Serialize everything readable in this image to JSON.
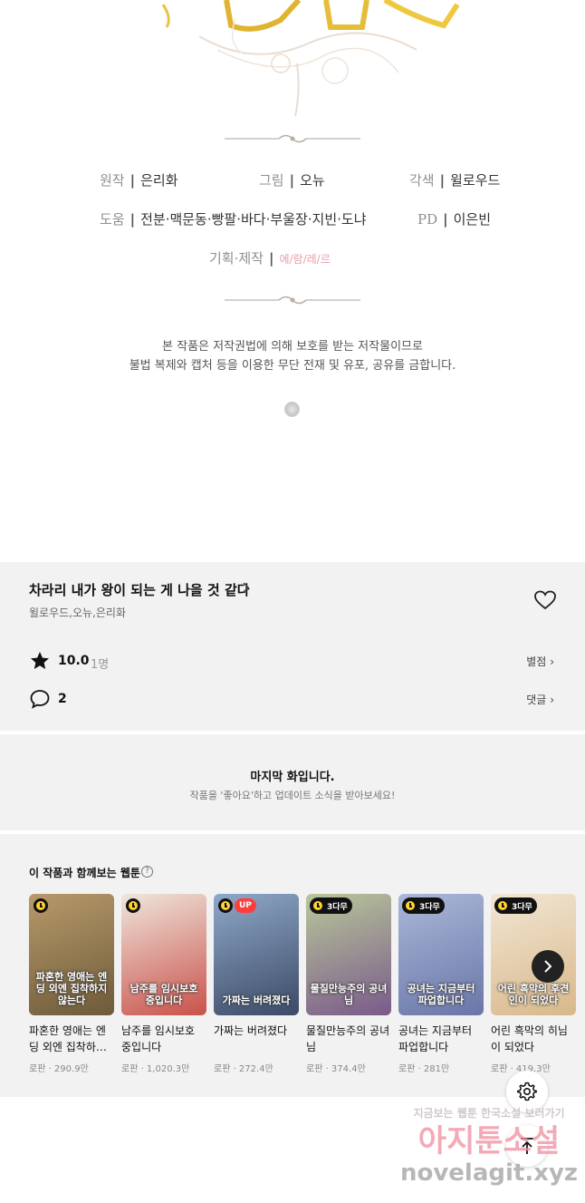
{
  "credits": {
    "rows": [
      [
        {
          "label": "원작",
          "value": "은리화"
        },
        {
          "label": "그림",
          "value": "오뉴"
        },
        {
          "label": "각색",
          "value": "윌로우드"
        }
      ],
      [
        {
          "label": "도움",
          "value": "전분·맥문동·빵팔·바다·부울장·지빈·도냐"
        },
        {
          "label": "PD",
          "value": "이은빈"
        }
      ]
    ],
    "production_label": "기획·제작",
    "studio_logo": "에/람/레/르",
    "copyright_line1": "본 작품은 저작권법에 의해 보호를 받는 저작물이므로",
    "copyright_line2": "불법 복제와 캡처 등을 이용한 무단 전재 및 유포, 공유를 금합니다."
  },
  "series": {
    "title": "차라리 내가 왕이 되는 게 나을 것 같다",
    "authors": "윌로우드,오뉴,은리화",
    "rating": "10.0",
    "rating_count": "1명",
    "rating_link": "별점",
    "comment_count": "2",
    "comment_link": "댓글"
  },
  "last_episode": {
    "title": "마지막 화입니다.",
    "subtitle": "작품을 '좋아요'하고 업데이트 소식을 받아보세요!"
  },
  "recommendations": {
    "heading": "이 작품과 함께보는 웹툰",
    "items": [
      {
        "title": "파혼한 영애는 엔딩 외엔 집착하…",
        "thumb_title": "파혼한 영애는 엔딩 외엔 집착하지 않는다",
        "meta": "로판 · 290.9만",
        "badge": "",
        "colors": [
          "#b89a6a",
          "#6d5a3a"
        ]
      },
      {
        "title": "남주를 임시보호 중입니다",
        "thumb_title": "남주를 임시보호 중입니다",
        "meta": "로판 · 1,020.3만",
        "badge": "",
        "colors": [
          "#efe6dc",
          "#c9514a"
        ]
      },
      {
        "title": "가짜는 버려졌다",
        "thumb_title": "가짜는 버려졌다",
        "meta": "로판 · 272.4만",
        "badge": "UP",
        "colors": [
          "#8fa8c8",
          "#3b4a66"
        ]
      },
      {
        "title": "물질만능주의 공녀님",
        "thumb_title": "물질만능주의 공녀님",
        "meta": "로판 · 374.4만",
        "badge": "3다무",
        "colors": [
          "#b8c79a",
          "#7a5a8a"
        ]
      },
      {
        "title": "공녀는 지금부터 파업합니다",
        "thumb_title": "공녀는 지금부터 파업합니다",
        "meta": "로판 · 281만",
        "badge": "3다무",
        "colors": [
          "#a9b8d8",
          "#6a76a8"
        ]
      },
      {
        "title": "어린 흑막의 히님이 되었다",
        "thumb_title": "어린 흑막의 후견인이 되었다",
        "meta": "로판 · 419.3만",
        "badge": "3다무",
        "colors": [
          "#f2e6d4",
          "#d8b88a"
        ]
      }
    ]
  },
  "watermark": {
    "line1": "지금보는 웹툰 한국소설 보러가기",
    "line2": "아지툰소설",
    "line3": "novelagit.xyz"
  }
}
